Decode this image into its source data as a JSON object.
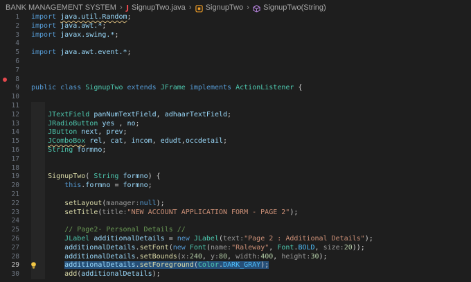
{
  "breadcrumb": {
    "items": [
      "BANK MANAGEMENT SYSTEM",
      "SignupTwo.java",
      "SignupTwo",
      "SignupTwo(String)"
    ],
    "icons": [
      "java-file-icon",
      "class-icon",
      "method-icon"
    ]
  },
  "editor": {
    "active_line": 29,
    "breakpoint_line": 8,
    "lines": [
      {
        "n": 1,
        "tokens": [
          [
            "kw",
            "import"
          ],
          [
            "pl",
            " "
          ],
          [
            "va",
            "java.util.Random"
          ],
          [
            "pl",
            ";"
          ]
        ],
        "wavy": 2
      },
      {
        "n": 2,
        "tokens": [
          [
            "kw",
            "import"
          ],
          [
            "pl",
            " "
          ],
          [
            "va",
            "java.awt.*"
          ],
          [
            "pl",
            ";"
          ]
        ]
      },
      {
        "n": 3,
        "tokens": [
          [
            "kw",
            "import"
          ],
          [
            "pl",
            " "
          ],
          [
            "va",
            "javax.swing.*"
          ],
          [
            "pl",
            ";"
          ]
        ]
      },
      {
        "n": 4,
        "tokens": []
      },
      {
        "n": 5,
        "tokens": [
          [
            "kw",
            "import"
          ],
          [
            "pl",
            " "
          ],
          [
            "va",
            "java.awt.event.*"
          ],
          [
            "pl",
            ";"
          ]
        ]
      },
      {
        "n": 6,
        "tokens": []
      },
      {
        "n": 7,
        "tokens": []
      },
      {
        "n": 8,
        "tokens": []
      },
      {
        "n": 9,
        "tokens": [
          [
            "kw",
            "public"
          ],
          [
            "pl",
            " "
          ],
          [
            "kw",
            "class"
          ],
          [
            "pl",
            " "
          ],
          [
            "ty",
            "SignupTwo"
          ],
          [
            "pl",
            " "
          ],
          [
            "kw",
            "extends"
          ],
          [
            "pl",
            " "
          ],
          [
            "ty",
            "JFrame"
          ],
          [
            "pl",
            " "
          ],
          [
            "kw",
            "implements"
          ],
          [
            "pl",
            " "
          ],
          [
            "ty",
            "ActionListener"
          ],
          [
            "pl",
            " {"
          ]
        ]
      },
      {
        "n": 10,
        "tokens": []
      },
      {
        "n": 11,
        "tokens": []
      },
      {
        "n": 12,
        "tokens": [
          [
            "pl",
            "    "
          ],
          [
            "ty",
            "JTextField"
          ],
          [
            "pl",
            " "
          ],
          [
            "va",
            "panNumTextField"
          ],
          [
            "pl",
            ", "
          ],
          [
            "va",
            "adhaarTextField"
          ],
          [
            "pl",
            ";"
          ]
        ]
      },
      {
        "n": 13,
        "tokens": [
          [
            "pl",
            "    "
          ],
          [
            "ty",
            "JRadioButton"
          ],
          [
            "pl",
            " "
          ],
          [
            "va",
            "yes"
          ],
          [
            "pl",
            " , "
          ],
          [
            "va",
            "no"
          ],
          [
            "pl",
            ";"
          ]
        ]
      },
      {
        "n": 14,
        "tokens": [
          [
            "pl",
            "    "
          ],
          [
            "ty",
            "JButton"
          ],
          [
            "pl",
            " "
          ],
          [
            "va",
            "next"
          ],
          [
            "pl",
            ", "
          ],
          [
            "va",
            "prev"
          ],
          [
            "pl",
            ";"
          ]
        ]
      },
      {
        "n": 15,
        "tokens": [
          [
            "pl",
            "    "
          ],
          [
            "ty",
            "JComboBox"
          ],
          [
            "pl",
            " "
          ],
          [
            "va",
            "rel"
          ],
          [
            "pl",
            ", "
          ],
          [
            "va",
            "cat"
          ],
          [
            "pl",
            ", "
          ],
          [
            "va",
            "incom"
          ],
          [
            "pl",
            ", "
          ],
          [
            "va",
            "edudt"
          ],
          [
            "pl",
            ","
          ],
          [
            "va",
            "occdetail"
          ],
          [
            "pl",
            ";"
          ]
        ],
        "wavy": 1
      },
      {
        "n": 16,
        "tokens": [
          [
            "pl",
            "    "
          ],
          [
            "ty",
            "String"
          ],
          [
            "pl",
            " "
          ],
          [
            "va",
            "formno"
          ],
          [
            "pl",
            ";"
          ]
        ]
      },
      {
        "n": 17,
        "tokens": []
      },
      {
        "n": 18,
        "tokens": []
      },
      {
        "n": 19,
        "tokens": [
          [
            "pl",
            "    "
          ],
          [
            "fn",
            "SignupTwo"
          ],
          [
            "pl",
            "( "
          ],
          [
            "ty",
            "String"
          ],
          [
            "pl",
            " "
          ],
          [
            "va",
            "formno"
          ],
          [
            "pl",
            ") {"
          ]
        ]
      },
      {
        "n": 20,
        "tokens": [
          [
            "pl",
            "        "
          ],
          [
            "kw",
            "this"
          ],
          [
            "pl",
            "."
          ],
          [
            "va",
            "formno"
          ],
          [
            "pl",
            " = "
          ],
          [
            "va",
            "formno"
          ],
          [
            "pl",
            ";"
          ]
        ]
      },
      {
        "n": 21,
        "tokens": []
      },
      {
        "n": 22,
        "tokens": [
          [
            "pl",
            "        "
          ],
          [
            "fn",
            "setLayout"
          ],
          [
            "pl",
            "("
          ],
          [
            "pn",
            "manager:"
          ],
          [
            "kw",
            "null"
          ],
          [
            "pl",
            ");"
          ]
        ]
      },
      {
        "n": 23,
        "tokens": [
          [
            "pl",
            "        "
          ],
          [
            "fn",
            "setTitle"
          ],
          [
            "pl",
            "("
          ],
          [
            "pn",
            "title:"
          ],
          [
            "st",
            "\"NEW ACCOUNT APPLICATION FORM - PAGE 2\""
          ],
          [
            "pl",
            ");"
          ]
        ]
      },
      {
        "n": 24,
        "tokens": []
      },
      {
        "n": 25,
        "tokens": [
          [
            "pl",
            "        "
          ],
          [
            "cm",
            "// Page2- Personal Details //"
          ]
        ]
      },
      {
        "n": 26,
        "tokens": [
          [
            "pl",
            "        "
          ],
          [
            "ty",
            "JLabel"
          ],
          [
            "pl",
            " "
          ],
          [
            "va",
            "additionalDetails"
          ],
          [
            "pl",
            " = "
          ],
          [
            "kw",
            "new"
          ],
          [
            "pl",
            " "
          ],
          [
            "ty",
            "JLabel"
          ],
          [
            "pl",
            "("
          ],
          [
            "pn",
            "text:"
          ],
          [
            "st",
            "\"Page 2 : Additional Details\""
          ],
          [
            "pl",
            ");"
          ]
        ]
      },
      {
        "n": 27,
        "tokens": [
          [
            "pl",
            "        "
          ],
          [
            "va",
            "additionalDetails"
          ],
          [
            "pl",
            "."
          ],
          [
            "fn",
            "setFont"
          ],
          [
            "pl",
            "("
          ],
          [
            "kw",
            "new"
          ],
          [
            "pl",
            " "
          ],
          [
            "ty",
            "Font"
          ],
          [
            "pl",
            "("
          ],
          [
            "pn",
            "name:"
          ],
          [
            "st",
            "\"Raleway\""
          ],
          [
            "pl",
            ", "
          ],
          [
            "ty",
            "Font"
          ],
          [
            "pl",
            "."
          ],
          [
            "en",
            "BOLD"
          ],
          [
            "pl",
            ", "
          ],
          [
            "pn",
            "size:"
          ],
          [
            "nu",
            "20"
          ],
          [
            "pl",
            "));"
          ]
        ]
      },
      {
        "n": 28,
        "tokens": [
          [
            "pl",
            "        "
          ],
          [
            "va",
            "additionalDetails"
          ],
          [
            "pl",
            "."
          ],
          [
            "fn",
            "setBounds"
          ],
          [
            "pl",
            "("
          ],
          [
            "pn",
            "x:"
          ],
          [
            "nu",
            "240"
          ],
          [
            "pl",
            ", "
          ],
          [
            "pn",
            "y:"
          ],
          [
            "nu",
            "80"
          ],
          [
            "pl",
            ", "
          ],
          [
            "pn",
            "width:"
          ],
          [
            "nu",
            "400"
          ],
          [
            "pl",
            ", "
          ],
          [
            "pn",
            "height:"
          ],
          [
            "nu",
            "30"
          ],
          [
            "pl",
            ");"
          ]
        ]
      },
      {
        "n": 29,
        "tokens": [
          [
            "pl",
            "        "
          ],
          [
            "va",
            "additionalDetails"
          ],
          [
            "pl",
            "."
          ],
          [
            "fn",
            "setForeground"
          ],
          [
            "pl",
            "("
          ],
          [
            "ty",
            "Color"
          ],
          [
            "pl",
            "."
          ],
          [
            "en",
            "DARK_GRAY"
          ],
          [
            "pl",
            ");"
          ]
        ],
        "selected": true
      },
      {
        "n": 30,
        "tokens": [
          [
            "pl",
            "        "
          ],
          [
            "fn",
            "add"
          ],
          [
            "pl",
            "("
          ],
          [
            "va",
            "additionalDetails"
          ],
          [
            "pl",
            ");"
          ]
        ]
      }
    ]
  }
}
